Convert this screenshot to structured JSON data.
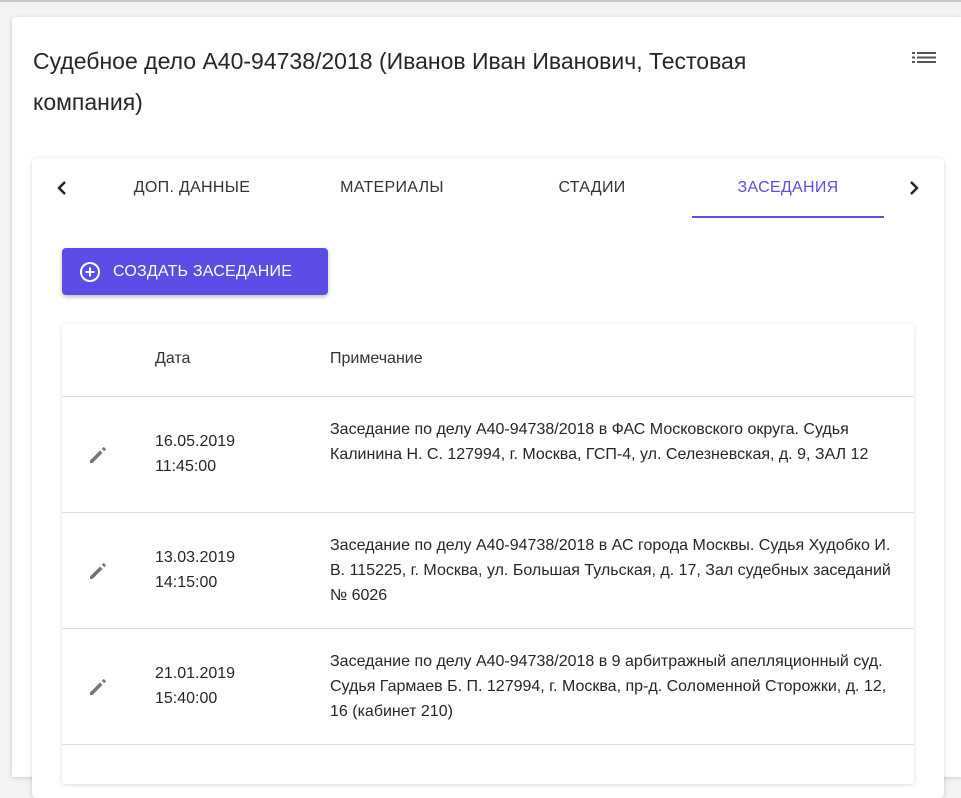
{
  "header": {
    "title": "Судебное дело А40-94738/2018 (Иванов Иван Иванович, Тестовая компания)",
    "menu_icon": "list-icon"
  },
  "tabs": {
    "items": [
      {
        "label": "ДОП. ДАННЫЕ"
      },
      {
        "label": "МАТЕРИАЛЫ"
      },
      {
        "label": "СТАДИИ"
      },
      {
        "label": "ЗАСЕДАНИЯ"
      }
    ],
    "active": "ЗАСЕДАНИЯ",
    "accent_color": "#5a4fe0"
  },
  "actions": {
    "create_label": "СОЗДАТЬ ЗАСЕДАНИЕ",
    "create_icon": "plus-circle-icon",
    "button_color": "#5b4de6"
  },
  "table": {
    "columns": [
      "Дата",
      "Примечание"
    ],
    "rows": [
      {
        "date": "16.05.2019",
        "time": "11:45:00",
        "note": "Заседание по делу А40-94738/2018 в ФАС Московского округа. Судья Калинина Н. С. 127994, г. Москва, ГСП-4, ул. Селезневская, д. 9, ЗАЛ 12"
      },
      {
        "date": "13.03.2019",
        "time": "14:15:00",
        "note": "Заседание по делу А40-94738/2018 в АС города Москвы. Судья Худобко И. В. 115225, г. Москва, ул. Большая Тульская, д. 17, Зал судебных заседаний № 6026"
      },
      {
        "date": "21.01.2019",
        "time": "15:40:00",
        "note": "Заседание по делу А40-94738/2018 в 9 арбитражный апелляционный суд. Судья Гармаев Б. П. 127994, г. Москва, пр-д. Соломенной Сторожки, д. 12, 16 (кабинет 210)"
      }
    ]
  }
}
